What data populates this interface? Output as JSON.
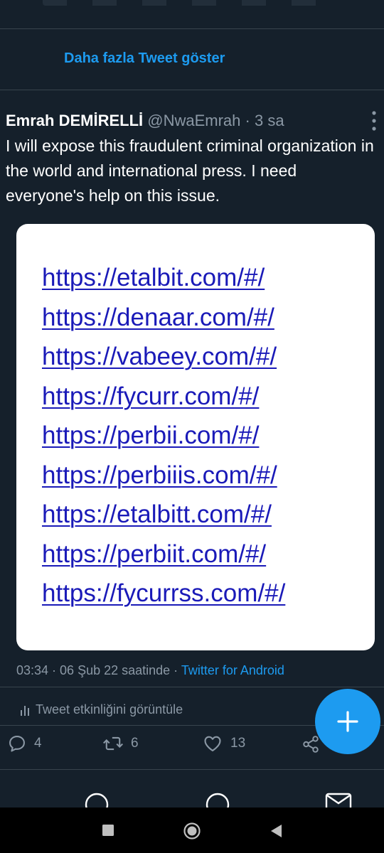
{
  "timeline": {
    "show_more_label": "Daha fazla Tweet göster"
  },
  "tweet": {
    "author_name": "Emrah DEMİRELLİ",
    "author_handle": "@NwaEmrah",
    "separator": "·",
    "age": "3 sa",
    "text": "I will expose this fraudulent criminal organization in the world and international press. I need everyone's help on this issue.",
    "image_urls": [
      "https://etalbit.com/#/",
      "https://denaar.com/#/",
      "https://vabeey.com/#/",
      "https://fycurr.com/#/",
      "https://perbii.com/#/",
      "https://perbiiis.com/#/",
      "https://etalbitt.com/#/",
      "https://perbiit.com/#/",
      "https://fycurrss.com/#/"
    ],
    "meta": {
      "time_date": "03:34 · 06 Şub 22 saatinde · ",
      "source": "Twitter for Android"
    },
    "analytics_label": "Tweet etkinliğini görüntüle",
    "counts": {
      "replies": "4",
      "retweets": "6",
      "likes": "13"
    }
  },
  "colors": {
    "background": "#15202b",
    "accent": "#1d9bf0",
    "muted": "#8b98a5",
    "divider": "#38444d",
    "link_in_image": "#1a1ab8"
  },
  "icons": {
    "more": "more-vertical-icon",
    "analytics": "bar-chart-icon",
    "reply": "reply-icon",
    "retweet": "retweet-icon",
    "like": "heart-icon",
    "share": "share-icon",
    "compose": "plus-icon"
  }
}
